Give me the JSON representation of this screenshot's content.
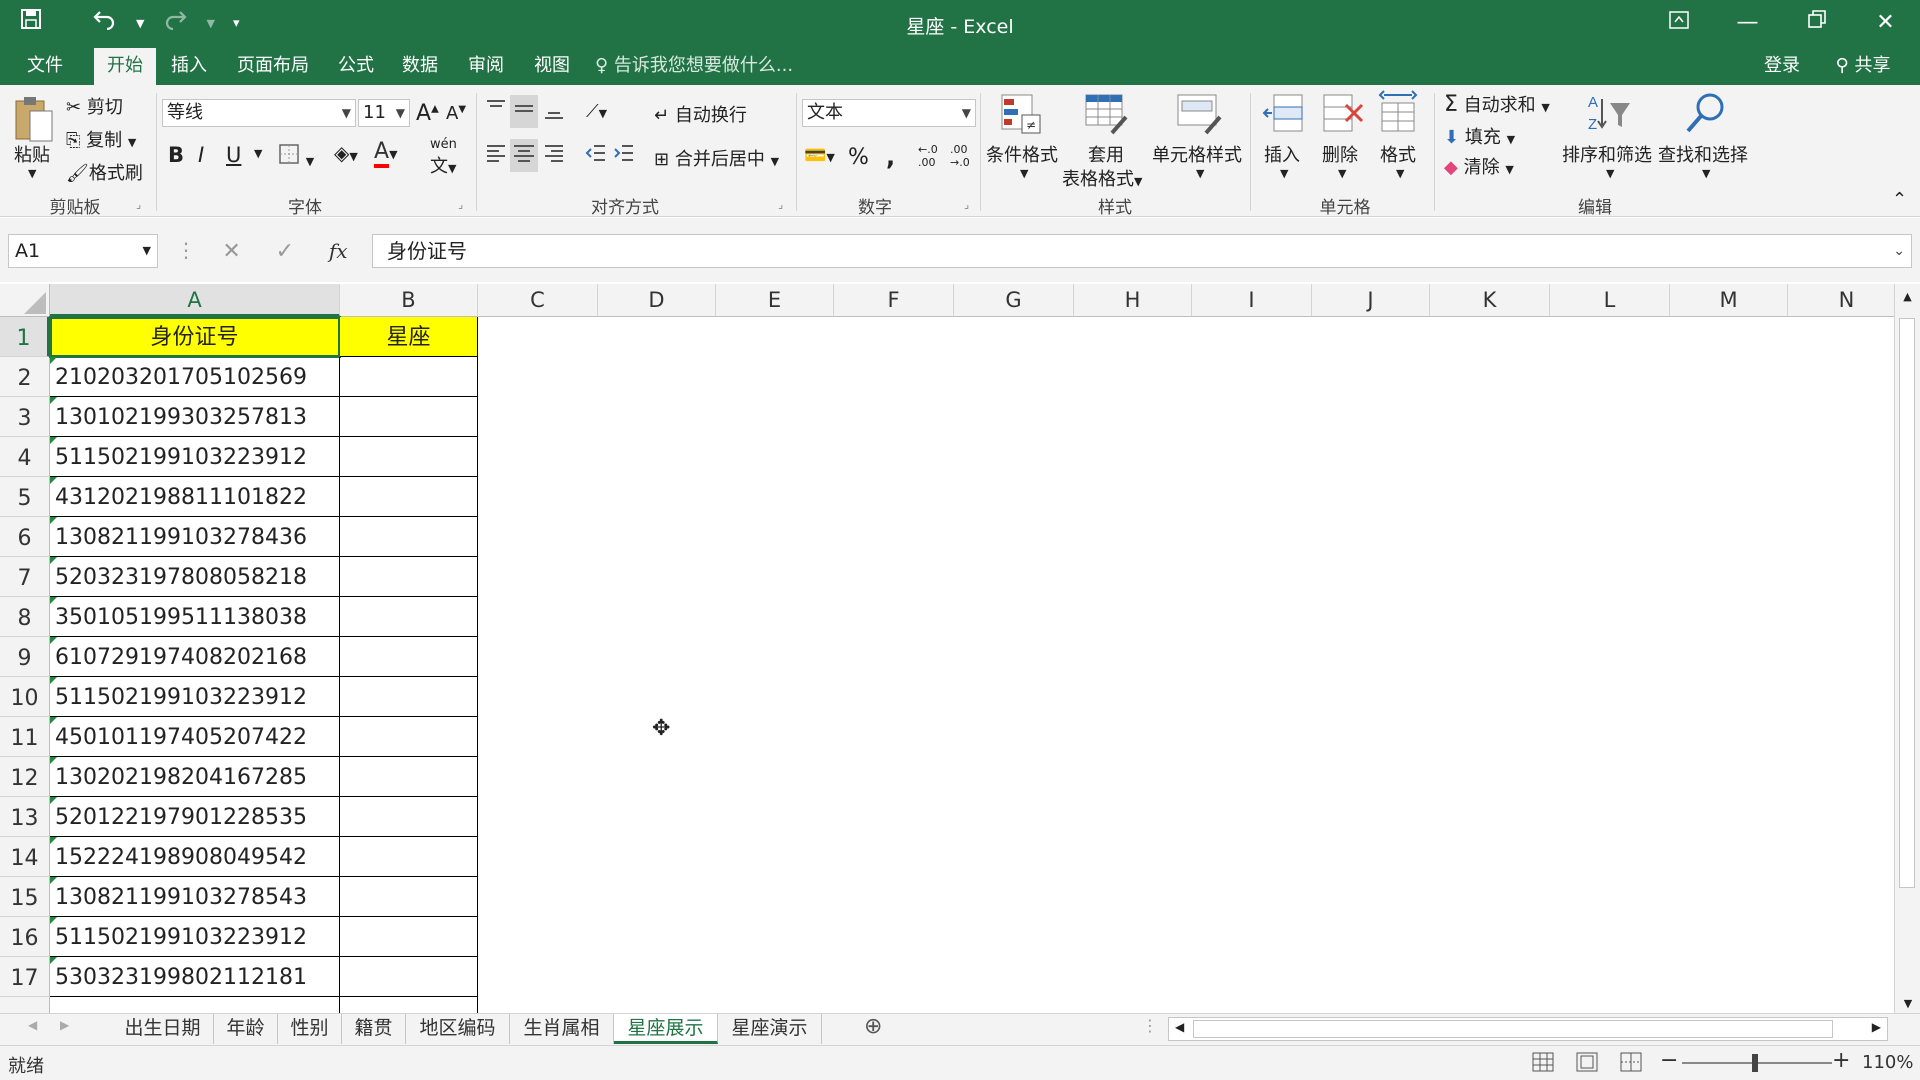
{
  "window": {
    "title": "星座 - Excel"
  },
  "qat": {
    "save_icon": "save-icon",
    "undo_icon": "undo-icon",
    "redo_icon": "redo-icon",
    "customize_icon": "customize-icon"
  },
  "window_buttons": {
    "ribbon_display": "ribbon-display-icon",
    "minimize": "minimize-icon",
    "restore": "restore-icon",
    "close": "close-icon"
  },
  "tabs": [
    "文件",
    "开始",
    "插入",
    "页面布局",
    "公式",
    "数据",
    "审阅",
    "视图"
  ],
  "active_tab": "开始",
  "tell_me": "告诉我您想要做什么...",
  "account": {
    "login": "登录",
    "share": "共享"
  },
  "ribbon": {
    "clipboard": {
      "paste": "粘贴",
      "cut": "剪切",
      "copy": "复制",
      "format_painter": "格式刷",
      "label": "剪贴板"
    },
    "font": {
      "name": "等线",
      "size": "11",
      "label": "字体",
      "bold": "B",
      "italic": "I",
      "underline": "U",
      "phonetic": "wén",
      "font_color_letter": "A"
    },
    "alignment": {
      "wrap": "自动换行",
      "merge": "合并后居中",
      "label": "对齐方式"
    },
    "number": {
      "format": "文本",
      "percent": "%",
      "comma": ",",
      "label": "数字"
    },
    "styles": {
      "conditional": "条件格式",
      "table_format_1": "套用",
      "table_format_2": "表格格式",
      "cell_styles": "单元格样式",
      "label": "样式"
    },
    "cells": {
      "insert": "插入",
      "delete": "删除",
      "format": "格式",
      "label": "单元格"
    },
    "editing": {
      "autosum": "自动求和",
      "fill": "填充",
      "clear": "清除",
      "sort_filter": "排序和筛选",
      "find_select": "查找和选择",
      "label": "编辑"
    }
  },
  "formula_bar": {
    "name_box": "A1",
    "fx": "fx",
    "content": "身份证号"
  },
  "columns": [
    "A",
    "B",
    "C",
    "D",
    "E",
    "F",
    "G",
    "H",
    "I",
    "J",
    "K",
    "L",
    "M",
    "N"
  ],
  "rows": [
    "1",
    "2",
    "3",
    "4",
    "5",
    "6",
    "7",
    "8",
    "9",
    "10",
    "11",
    "12",
    "13",
    "14",
    "15",
    "16",
    "17"
  ],
  "table": {
    "headers": [
      "身份证号",
      "星座"
    ],
    "id_numbers": [
      "210203201705102569",
      "130102199303257813",
      "511502199103223912",
      "431202198811101822",
      "130821199103278436",
      "520323197808058218",
      "350105199511138038",
      "610729197408202168",
      "511502199103223912",
      "450101197405207422",
      "130202198204167285",
      "520122197901228535",
      "152224198908049542",
      "130821199103278543",
      "511502199103223912",
      "530323199802112181"
    ]
  },
  "sheets": [
    "出生日期",
    "年龄",
    "性别",
    "籍贯",
    "地区编码",
    "生肖属相",
    "星座展示",
    "星座演示"
  ],
  "active_sheet": "星座展示",
  "status": {
    "ready": "就绪",
    "zoom": "110%"
  },
  "colors": {
    "excel_green": "#217346",
    "header_fill": "#ffff00"
  }
}
